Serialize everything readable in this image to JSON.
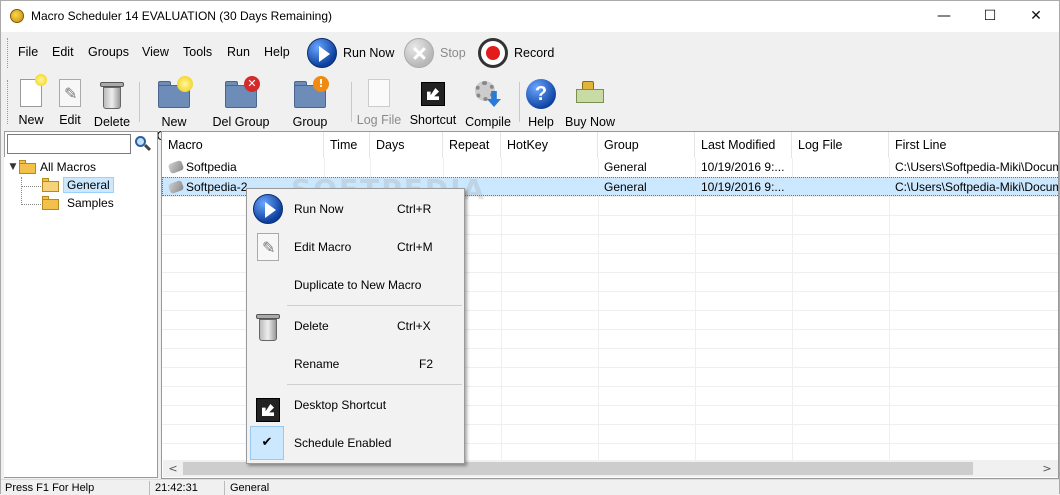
{
  "window": {
    "title": "Macro Scheduler 14 EVALUATION (30 Days Remaining)",
    "minimize_glyph": "—",
    "maximize_glyph": "☐",
    "close_glyph": "✕"
  },
  "menubar": {
    "items": [
      "File",
      "Edit",
      "Groups",
      "View",
      "Tools",
      "Run",
      "Help"
    ],
    "run_now": "Run Now",
    "stop": "Stop",
    "record": "Record"
  },
  "toolbar": {
    "new": "New",
    "edit": "Edit",
    "delete": "Delete",
    "new_group": "New Group",
    "del_group": "Del Group",
    "group_props": "Group Props",
    "log_file": "Log File",
    "shortcut": "Shortcut",
    "compile": "Compile",
    "help": "Help",
    "buy_now": "Buy Now"
  },
  "tree": {
    "root": "All Macros",
    "children": [
      "General",
      "Samples"
    ],
    "selected": "General"
  },
  "list": {
    "columns": [
      "Macro",
      "Time",
      "Days",
      "Repeat",
      "HotKey",
      "Group",
      "Last Modified",
      "Log File",
      "First Line"
    ],
    "rows": [
      {
        "macro": "Softpedia",
        "time": "",
        "days": "",
        "repeat": "",
        "hotkey": "",
        "group": "General",
        "modified": "10/19/2016 9:...",
        "logfile": "",
        "firstline": "C:\\Users\\Softpedia-Miki\\Docum"
      },
      {
        "macro": "Softpedia-2",
        "time": "",
        "days": "",
        "repeat": "",
        "hotkey": "",
        "group": "General",
        "modified": "10/19/2016 9:...",
        "logfile": "",
        "firstline": "C:\\Users\\Softpedia-Miki\\Docum"
      }
    ]
  },
  "context_menu": {
    "run_now": "Run Now",
    "run_now_key": "Ctrl+R",
    "edit_macro": "Edit Macro",
    "edit_macro_key": "Ctrl+M",
    "duplicate": "Duplicate to New Macro",
    "delete": "Delete",
    "delete_key": "Ctrl+X",
    "rename": "Rename",
    "rename_key": "F2",
    "desktop_shortcut": "Desktop Shortcut",
    "schedule_enabled": "Schedule Enabled",
    "check_glyph": "✔"
  },
  "statusbar": {
    "hint": "Press F1 For Help",
    "time": "21:42:31",
    "group": "General"
  },
  "watermark": "SOFTPEDIA",
  "colors": {
    "selection": "#cce8ff",
    "record_red": "#e21b1b",
    "run_blue": "#0b3f9e"
  }
}
